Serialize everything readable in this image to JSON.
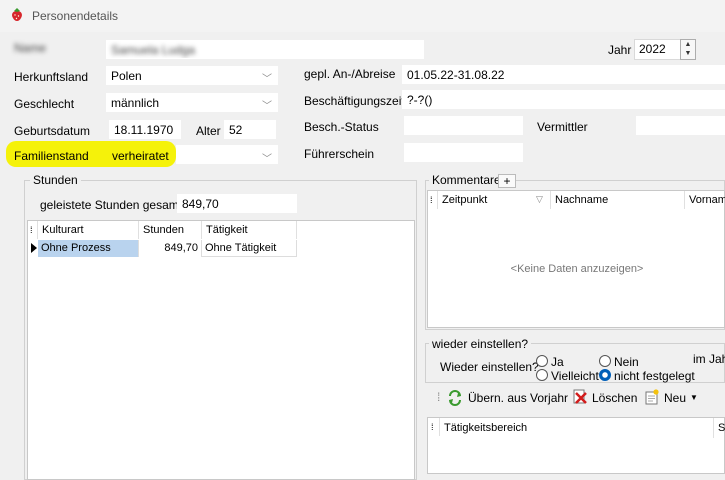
{
  "window": {
    "title": "Personendetails",
    "icon": "strawberry-icon"
  },
  "person": {
    "name_label": "Name",
    "name_value": "Samuela Ludga",
    "herkunftsland_label": "Herkunftsland",
    "herkunftsland_value": "Polen",
    "geschlecht_label": "Geschlecht",
    "geschlecht_value": "männlich",
    "geburtsdatum_label": "Geburtsdatum",
    "geburtsdatum_value": "18.11.1970",
    "alter_label": "Alter",
    "alter_value": "52",
    "familienstand_label": "Familienstand",
    "familienstand_value": "verheiratet",
    "jahr_label": "Jahr",
    "jahr_value": "2022",
    "anabreise_label": "gepl. An-/Abreise",
    "anabreise_value": "01.05.22-31.08.22",
    "beschaeftigungszeitr_label": "Beschäftigungszeitr.",
    "beschaeftigungszeitr_value": "?-?()",
    "besch_status_label": "Besch.-Status",
    "besch_status_value": "",
    "vermittler_label": "Vermittler",
    "vermittler_value": "",
    "fuehrerschein_label": "Führerschein",
    "fuehrerschein_value": ""
  },
  "stunden": {
    "group_title": "Stunden",
    "total_label": "geleistete Stunden gesamt:",
    "total_value": "849,70",
    "columns": [
      "Kulturart",
      "Stunden",
      "Tätigkeit"
    ],
    "rows": [
      {
        "kulturart": "Ohne Prozess",
        "stunden": "849,70",
        "taetigkeit": "Ohne Tätigkeit"
      }
    ]
  },
  "kommentare": {
    "group_title": "Kommentare",
    "add_button": "+",
    "columns": [
      "Zeitpunkt",
      "Nachname",
      "Vorname"
    ],
    "empty_text": "<Keine Daten anzuzeigen>"
  },
  "wieder": {
    "group_title": "wieder einstellen?",
    "question_label": "Wieder einstellen?",
    "options": [
      "Ja",
      "Nein",
      "Vielleicht",
      "nicht festgelegt"
    ],
    "selected": "nicht festgelegt",
    "im_jahr_label": "im Jahr"
  },
  "toolbar": {
    "uebern_label": "Übern. aus Vorjahr",
    "loeschen_label": "Löschen",
    "neu_label": "Neu"
  },
  "taetigkeit_grid": {
    "columns": [
      "Tätigkeitsbereich",
      "St"
    ]
  },
  "colors": {
    "highlight": "#f5f20a",
    "selected_row": "#b9d3ee",
    "radio_checked": "#005fb8"
  }
}
